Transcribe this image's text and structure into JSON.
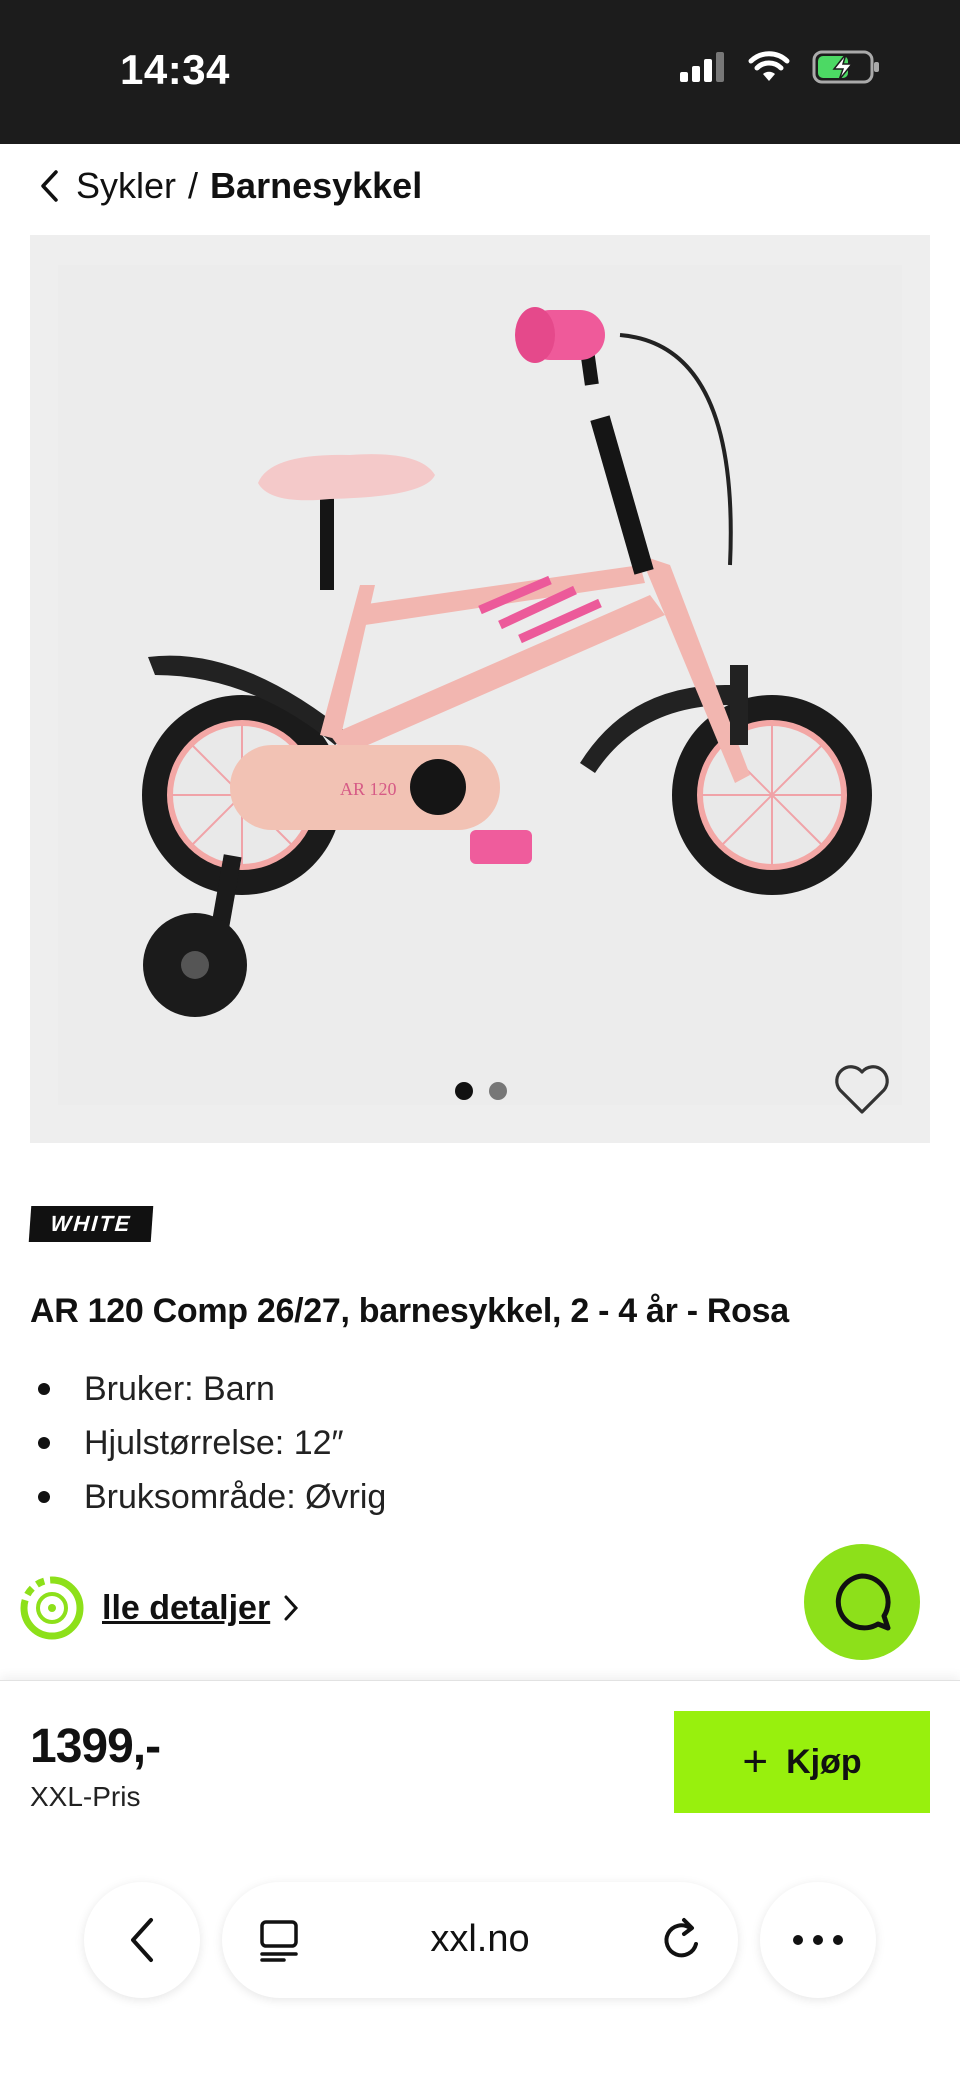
{
  "status_bar": {
    "time": "14:34",
    "battery_state": "charging"
  },
  "breadcrumb": {
    "parent": "Sykler",
    "separator": "/",
    "current": "Barnesykkel"
  },
  "gallery": {
    "image_alt": "AR 120 Comp barnesykkel rosa",
    "frame_label": "AR 120",
    "dots_total": 2,
    "dots_active": 1
  },
  "brand": {
    "name": "WHITE"
  },
  "product": {
    "title": "AR 120 Comp 26/27, barnesykkel, 2 - 4 år - Rosa",
    "specs": [
      "Bruker: Barn",
      "Hjulstørrelse: 12″",
      "Bruksområde: Øvrig"
    ],
    "details_link": "lle detaljer"
  },
  "price_bar": {
    "price": "1399,-",
    "price_label": "XXL-Pris",
    "buy_label": "Kjøp"
  },
  "browser": {
    "url": "xxl.no"
  },
  "colors": {
    "accent": "#98f00d",
    "chat": "#8de01a",
    "bike_pink": "#f3b8b1",
    "hot_pink": "#ec5a9a"
  }
}
